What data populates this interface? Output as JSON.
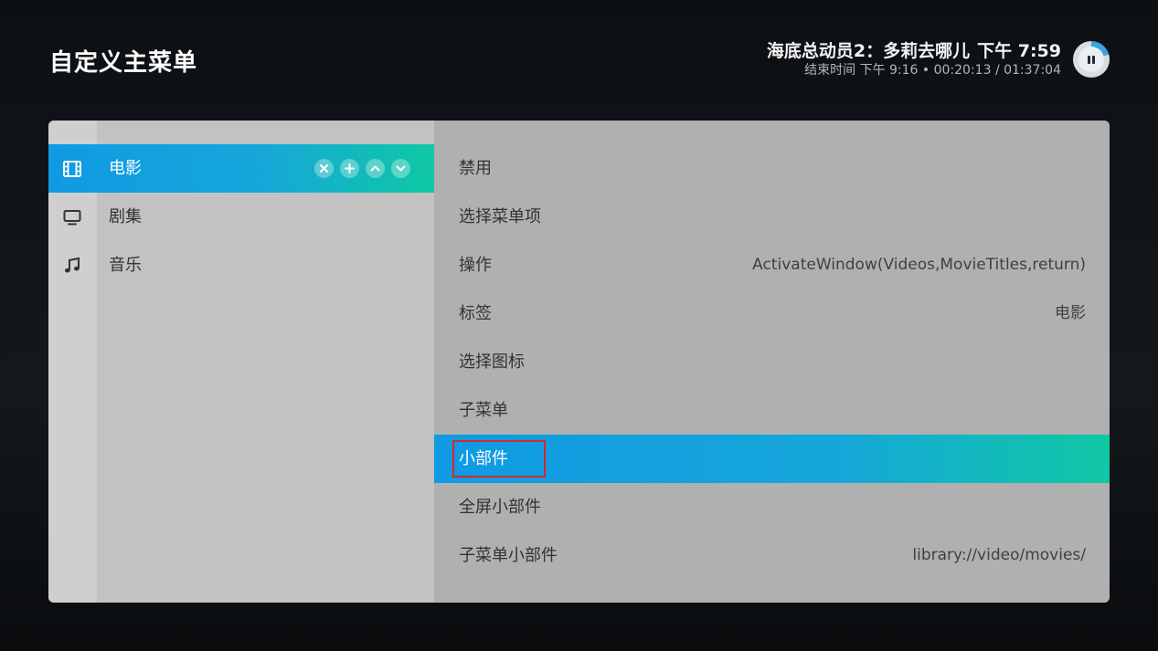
{
  "header": {
    "title": "自定义主菜单"
  },
  "now_playing": {
    "title": "海底总动员2：多莉去哪儿",
    "clock": "下午 7:59",
    "details": "结束时间 下午 9:16 • 00:20:13 / 01:37:04",
    "progress": 0.208,
    "icon": "pause-icon"
  },
  "menu_items": [
    {
      "label": "电影",
      "icon": "film-icon",
      "selected": true
    },
    {
      "label": "剧集",
      "icon": "tv-icon",
      "selected": false
    },
    {
      "label": "音乐",
      "icon": "music-note-icon",
      "selected": false
    }
  ],
  "item_controls": [
    "remove-icon",
    "add-icon",
    "move-up-icon",
    "move-down-icon"
  ],
  "options": [
    {
      "label": "禁用",
      "value": ""
    },
    {
      "label": "选择菜单项",
      "value": ""
    },
    {
      "label": "操作",
      "value": "ActivateWindow(Videos,MovieTitles,return)"
    },
    {
      "label": "标签",
      "value": "电影"
    },
    {
      "label": "选择图标",
      "value": ""
    },
    {
      "label": "子菜单",
      "value": ""
    },
    {
      "label": "小部件",
      "value": "",
      "selected": true
    },
    {
      "label": "全屏小部件",
      "value": ""
    },
    {
      "label": "子菜单小部件",
      "value": "library://video/movies/"
    }
  ],
  "colors": {
    "accent_start": "#0f9ae3",
    "accent_end": "#0fc8a3",
    "annotation_box": "#d8262b"
  }
}
